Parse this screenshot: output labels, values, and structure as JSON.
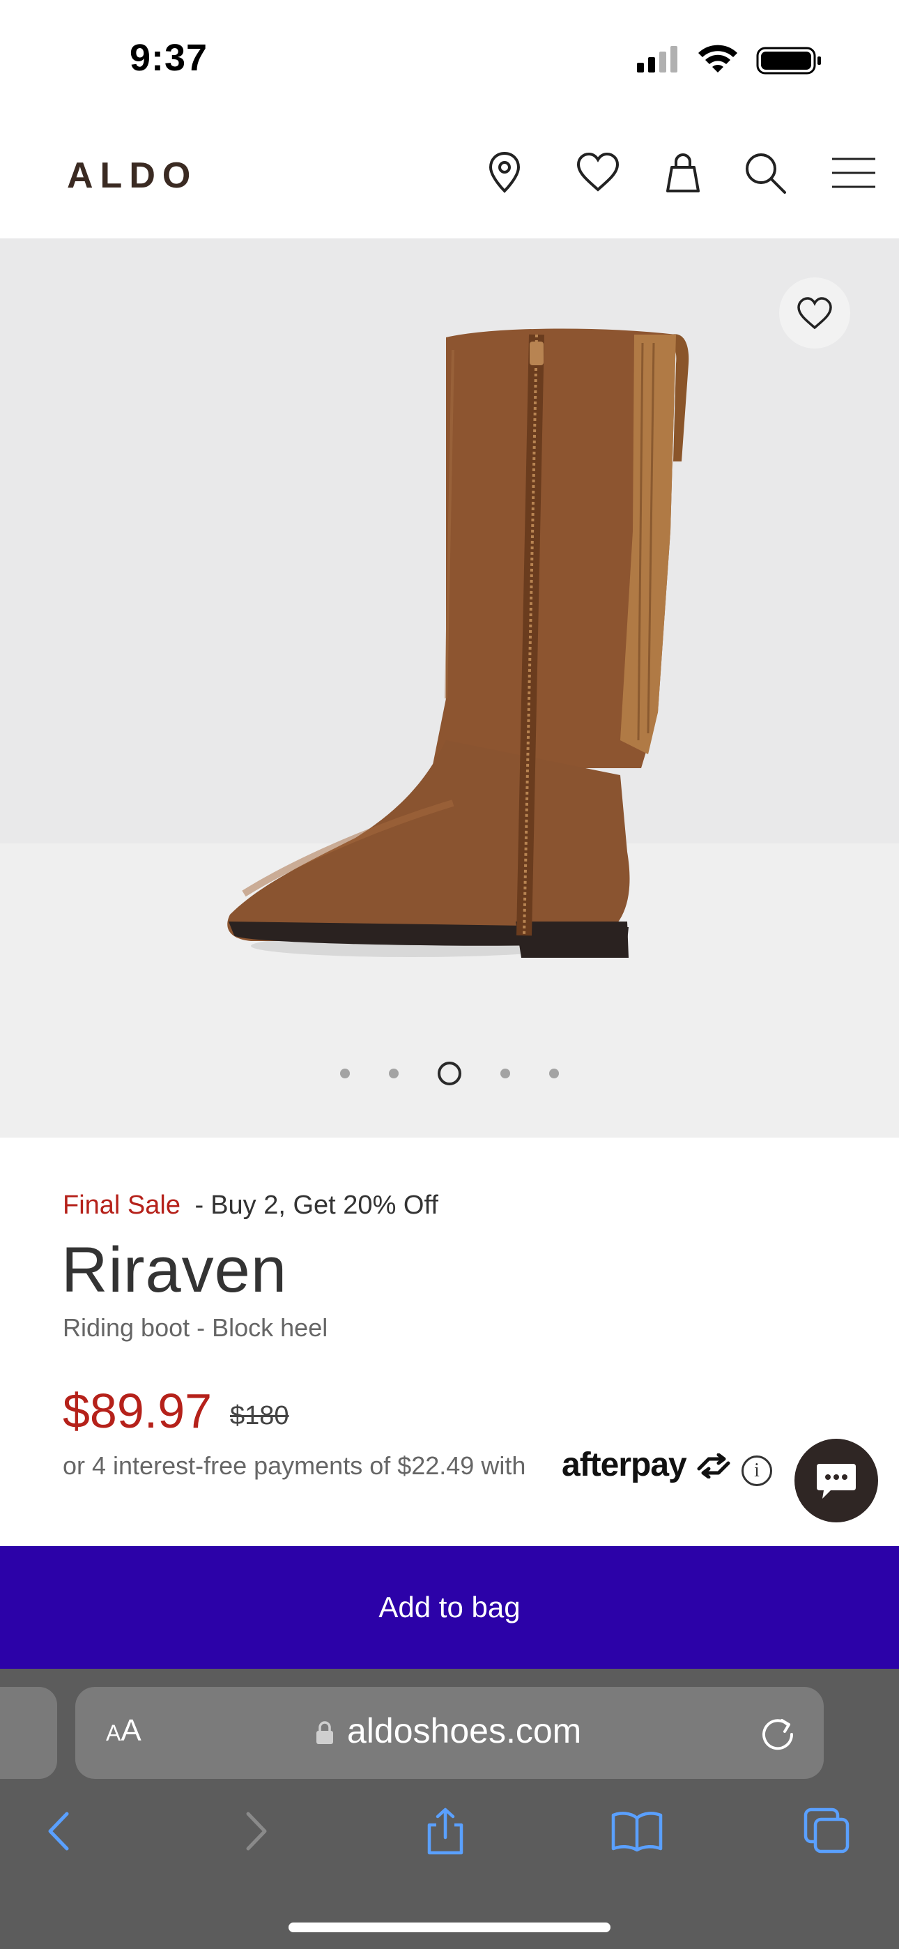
{
  "status_bar": {
    "time": "9:37",
    "icons": [
      "signal-icon",
      "wifi-icon",
      "battery-icon"
    ]
  },
  "header": {
    "logo": "ALDO",
    "icons": [
      "location-pin-icon",
      "heart-icon",
      "bag-icon",
      "search-icon",
      "menu-icon"
    ]
  },
  "gallery": {
    "image_count": 5,
    "active_index": 2,
    "favorite_icon": "heart-icon"
  },
  "product": {
    "promo_label": "Final Sale",
    "promo_separator": "-",
    "promo_text": "Buy 2, Get 20% Off",
    "name": "Riraven",
    "subtitle": "Riding boot - Block heel",
    "price": "$89.97",
    "original_price": "$180",
    "installments_text": "or 4 interest-free payments of $22.49 with",
    "afterpay_label": "afterpay",
    "info_label": "i"
  },
  "cta": {
    "add_to_bag": "Add to bag"
  },
  "browser": {
    "aa_small": "A",
    "aa_large": "A",
    "url": "aldoshoes.com",
    "toolbar_icons": [
      "back-icon",
      "forward-icon",
      "share-icon",
      "bookmarks-icon",
      "tabs-icon"
    ]
  },
  "colors": {
    "sale_red": "#b5211a",
    "cta_purple": "#2c02a8",
    "chat_bg": "#2f2624",
    "ios_blue": "#5aa0ff"
  }
}
